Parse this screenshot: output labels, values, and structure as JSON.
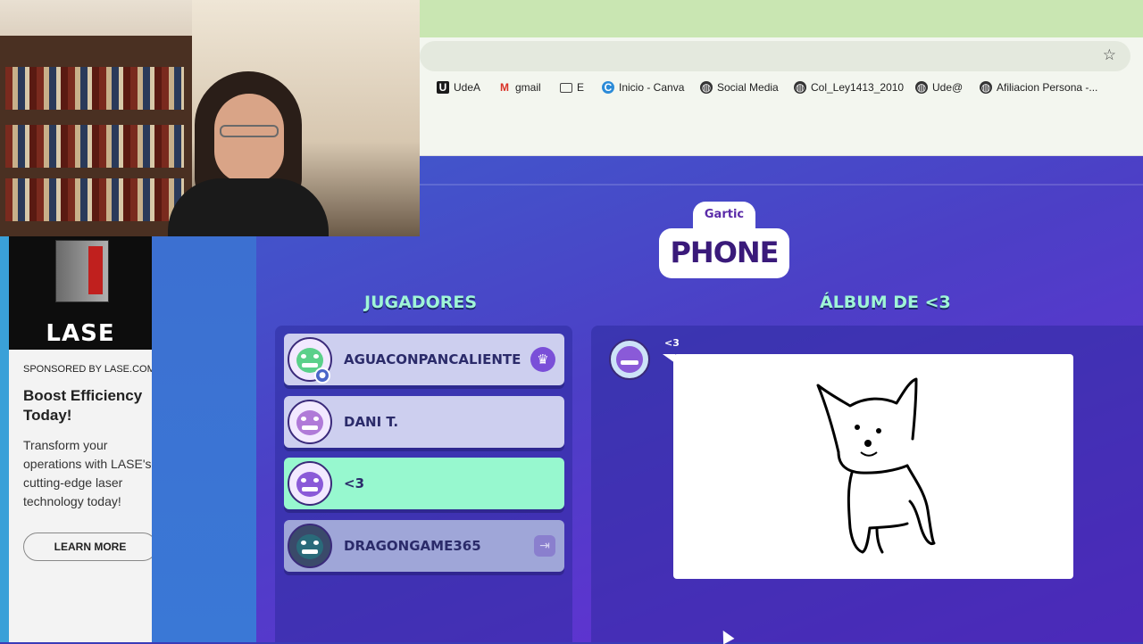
{
  "browser": {
    "bookmarks": [
      {
        "icon": "udea-icon",
        "label": "UdeA"
      },
      {
        "icon": "gmail-icon",
        "label": "gmail"
      },
      {
        "icon": "folder-icon",
        "label": "E"
      },
      {
        "icon": "canva-icon",
        "label": "Inicio - Canva"
      },
      {
        "icon": "globe-icon",
        "label": "Social Media"
      },
      {
        "icon": "globe-icon",
        "label": "Col_Ley1413_2010"
      },
      {
        "icon": "globe-icon",
        "label": "Ude@"
      },
      {
        "icon": "globe-icon",
        "label": "Afiliacion Persona -..."
      }
    ]
  },
  "game": {
    "logo_top": "Gartic",
    "logo_bottom": "PHONE",
    "players_heading": "JUGADORES",
    "album_heading": "ÁLBUM DE <3",
    "players": [
      {
        "name": "AGUACONPANCALIENTE",
        "state": "host",
        "avatar_color": "#5bd08a"
      },
      {
        "name": "DANI T.",
        "state": "normal",
        "avatar_color": "#b07ad8"
      },
      {
        "name": "<3",
        "state": "active",
        "avatar_color": "#8a5ad8"
      },
      {
        "name": "DRAGONGAME365",
        "state": "disconnected",
        "avatar_color": "#2a6a7a"
      }
    ],
    "album": {
      "author": "<3",
      "drawing": "dog sketch"
    }
  },
  "ad": {
    "brand": "LASE",
    "sponsor": "SPONSORED BY LASE.COM",
    "title": "Boost Efficiency Today!",
    "body": "Transform your operations with LASE's cutting-edge laser technology today!",
    "cta": "LEARN MORE"
  }
}
